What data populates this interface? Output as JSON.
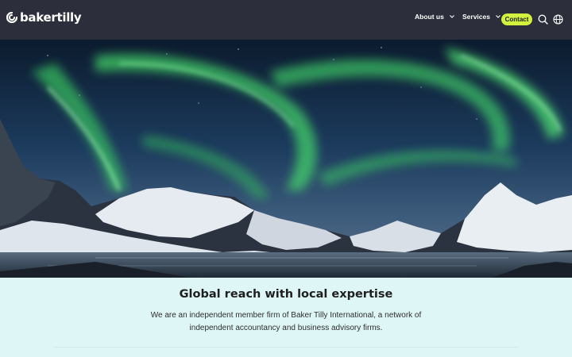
{
  "header": {
    "logo_text": "bakertilly",
    "nav": {
      "about_label": "About us",
      "services_label": "Services",
      "contact_label": "Contact"
    },
    "icons": [
      "search-icon",
      "globe-icon",
      "chevron-down-icon"
    ]
  },
  "hero": {
    "image": "northern-lights-over-snowy-mountains-and-lake"
  },
  "main": {
    "headline": "Global reach with local expertise",
    "description": "We are an independent member firm of Baker Tilly International, a network of independent accountancy and business advisory firms."
  },
  "colors": {
    "header_bg": "#2c2f3b",
    "accent": "#d2f23e",
    "content_bg": "#dff6f7",
    "text": "#1f1f1f"
  }
}
